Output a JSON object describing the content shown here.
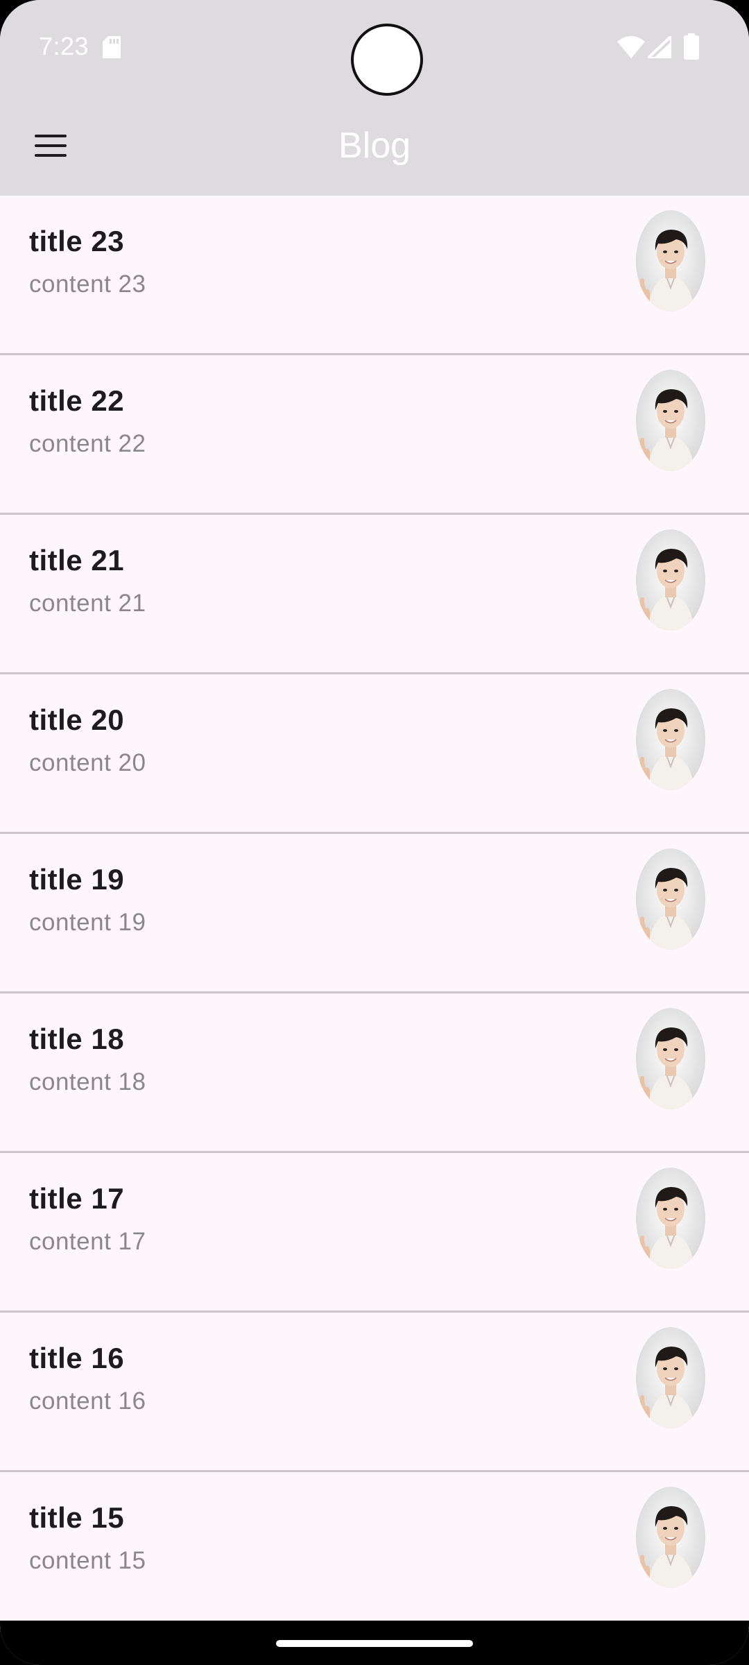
{
  "status_bar": {
    "time": "7:23",
    "icons": [
      "sd-card-icon",
      "wifi-icon",
      "signal-icon",
      "battery-icon"
    ]
  },
  "app_bar": {
    "title": "Blog",
    "menu_icon": "menu-icon"
  },
  "posts": [
    {
      "title": "title 23",
      "content": "content 23"
    },
    {
      "title": "title 22",
      "content": "content 22"
    },
    {
      "title": "title 21",
      "content": "content 21"
    },
    {
      "title": "title 20",
      "content": "content 20"
    },
    {
      "title": "title 19",
      "content": "content 19"
    },
    {
      "title": "title 18",
      "content": "content 18"
    },
    {
      "title": "title 17",
      "content": "content 17"
    },
    {
      "title": "title 16",
      "content": "content 16"
    },
    {
      "title": "title 15",
      "content": "content 15"
    }
  ],
  "colors": {
    "app_bar_bg": "#dedbdf",
    "list_bg": "#fdf7fc",
    "divider": "#c9c5ca",
    "title_text": "#1d1b20",
    "content_text": "#8a878c"
  }
}
